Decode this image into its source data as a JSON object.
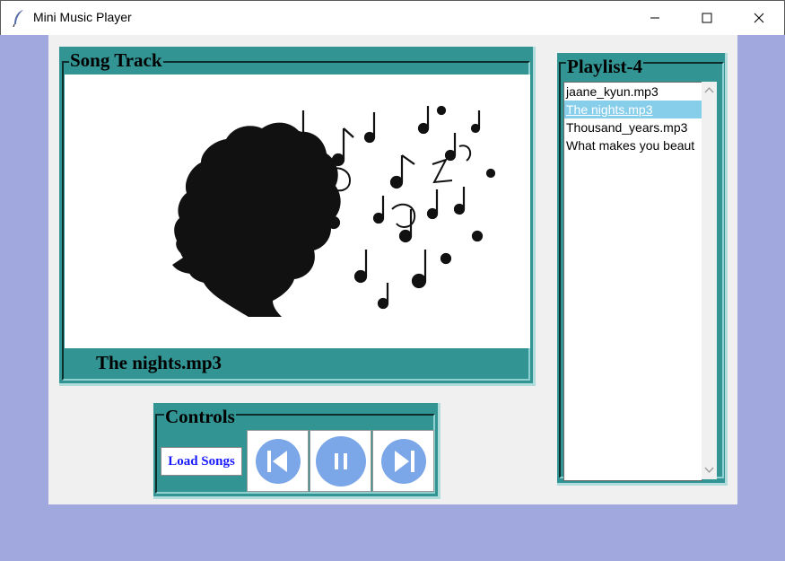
{
  "window": {
    "title": "Mini Music Player",
    "icon": "feather-icon",
    "controls": [
      "minimize-icon",
      "maximize-icon",
      "close-icon"
    ]
  },
  "song_track": {
    "legend": "Song Track",
    "now_playing": "The nights.mp3",
    "artwork": "silhouette-with-music-notes"
  },
  "playlist": {
    "legend": "Playlist-4",
    "items": [
      {
        "label": "jaane_kyun.mp3",
        "selected": false
      },
      {
        "label": "The nights.mp3",
        "selected": true
      },
      {
        "label": "Thousand_years.mp3",
        "selected": false
      },
      {
        "label": "What makes you beaut",
        "selected": false
      }
    ]
  },
  "controls": {
    "legend": "Controls",
    "load_label": "Load Songs",
    "buttons": [
      "previous-icon",
      "pause-icon",
      "next-icon"
    ]
  },
  "colors": {
    "desktop": "#a0a8de",
    "frame": "#339494",
    "selection": "#87ceeb",
    "control_icon": "#7ba7e8",
    "load_text": "#1a1aff"
  }
}
